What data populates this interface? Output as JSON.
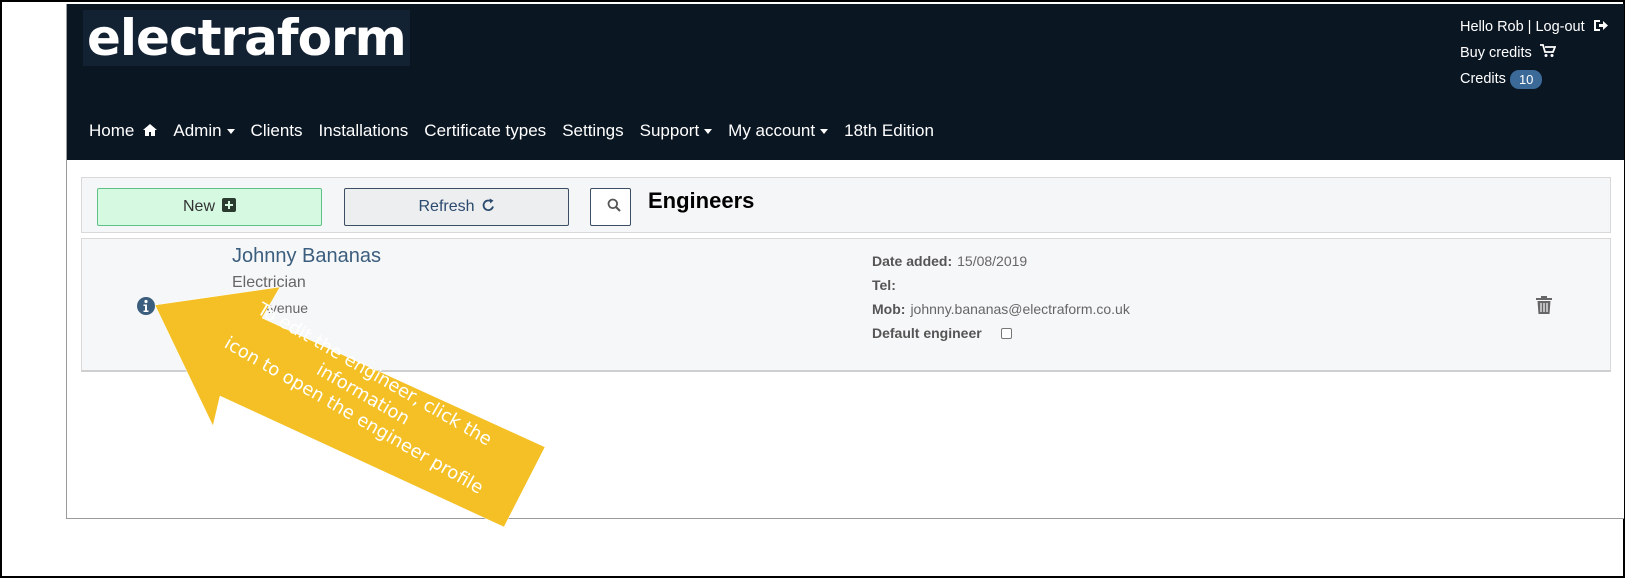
{
  "header": {
    "logo_text": "electraform",
    "greeting": "Hello Rob",
    "logout_label": "Log-out",
    "buy_credits_label": "Buy credits",
    "credits_label": "Credits",
    "credits_count": "10"
  },
  "nav": {
    "home": "Home",
    "admin": "Admin",
    "clients": "Clients",
    "installations": "Installations",
    "certificate_types": "Certificate types",
    "settings": "Settings",
    "support": "Support",
    "my_account": "My account",
    "edition": "18th Edition"
  },
  "toolbar": {
    "new_label": "New",
    "refresh_label": "Refresh",
    "page_title": "Engineers"
  },
  "engineer": {
    "name": "Johnny Bananas",
    "role": "Electrician",
    "address": "acia Avenue",
    "date_added_label": "Date added:",
    "date_added": "15/08/2019",
    "tel_label": "Tel:",
    "tel": "",
    "mob_label": "Mob:",
    "mob": "johnny.bananas@electraform.co.uk",
    "default_label": "Default engineer",
    "default_checked": false
  },
  "callout": {
    "line1": "To edit the engineer, click the",
    "line2": "information",
    "line3": "icon to open the engineer profile"
  },
  "colors": {
    "header_bg": "#0b1623",
    "link_blue": "#3b5d7e",
    "callout_yellow": "#f4c025",
    "new_button_bg": "#d6f9e2"
  },
  "icons": {
    "home": "home-icon",
    "logout": "logout-icon",
    "cart": "cart-icon",
    "plus": "plus-square-icon",
    "refresh": "refresh-icon",
    "search": "search-icon",
    "info": "info-circle-icon",
    "trash": "trash-icon"
  }
}
